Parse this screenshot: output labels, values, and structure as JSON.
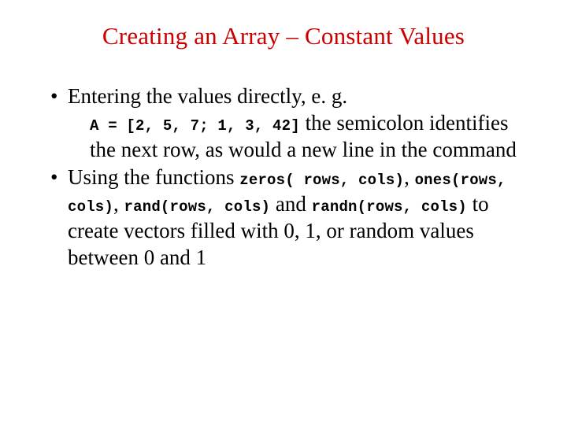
{
  "title": "Creating an Array – Constant Values",
  "b1": {
    "lead": "Entering the values directly, e. g.",
    "code": "A = [2, 5, 7; 1, 3, 42]",
    "after": " the semicolon identifies the next row, as would a new line in the command"
  },
  "b2": {
    "lead": "Using the functions ",
    "c1": "zeros( rows, cols)",
    "sep1": ", ",
    "c2": "ones(rows, cols)",
    "sep2": ", ",
    "c3": "rand(rows, cols)",
    "and": " and ",
    "c4": "randn(rows, cols)",
    "tail": " to create vectors filled with 0, 1, or random values between 0 and 1"
  }
}
